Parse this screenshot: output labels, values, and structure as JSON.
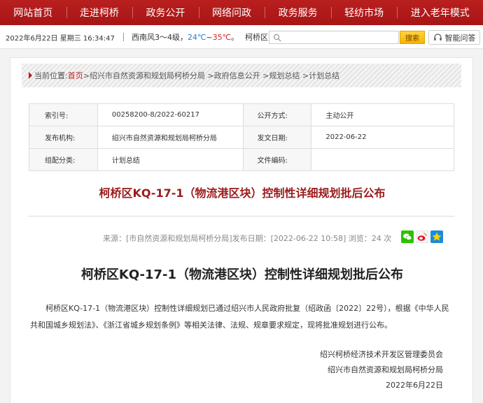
{
  "nav": {
    "items": [
      {
        "label": "网站首页"
      },
      {
        "label": "走进柯桥"
      },
      {
        "label": "政务公开"
      },
      {
        "label": "网络问政"
      },
      {
        "label": "政务服务"
      },
      {
        "label": "轻纺市场"
      },
      {
        "label": "进入老年模式"
      }
    ]
  },
  "infobar": {
    "datetime": "2022年6月22日 星期三 16:34:47",
    "weather_prefix": "西南风3～4级，",
    "temp_low": "24℃",
    "temp_sep": "~",
    "temp_high": "35℃",
    "temp_suffix": "。",
    "region": "柯桥区(",
    "search_placeholder": "",
    "search_button": "搜索",
    "qa_button": "智能问答"
  },
  "breadcrumb": {
    "prefix": "当前位置:",
    "home": "首页",
    "path": ">绍兴市自然资源和规划局柯桥分局 >政府信息公开 >规划总结 >计划总结"
  },
  "meta": {
    "rows": [
      {
        "l1": "索引号:",
        "v1": "00258200-8/2022-60217",
        "l2": "公开方式:",
        "v2": "主动公开"
      },
      {
        "l1": "发布机构:",
        "v1": "绍兴市自然资源和规划局柯桥分局",
        "l2": "发文日期:",
        "v2": "2022-06-22"
      },
      {
        "l1": "组配分类:",
        "v1": "计划总结",
        "l2": "文件编码:",
        "v2": ""
      }
    ]
  },
  "red_title": "柯桥区KQ-17-1（物流港区块）控制性详细规划批后公布",
  "source_line": "来源：[市自然资源和规划局柯桥分局]发布日期：[2022-06-22 10:58] 浏览：24 次",
  "share": {
    "wechat": "wechat-icon",
    "weibo": "weibo-icon",
    "qzone": "qzone-icon"
  },
  "article": {
    "title": "柯桥区KQ-17-1（物流港区块）控制性详细规划批后公布",
    "body": "柯桥区KQ-17-1（物流港区块）控制性详细规划已通过绍兴市人民政府批复（绍政函〔2022〕22号），根据《中华人民共和国城乡规划法》、《浙江省城乡规划条例》等相关法律、法规、规章要求规定，现将批准规划进行公布。",
    "sig1": "绍兴柯桥经济技术开发区管理委员会",
    "sig2": "绍兴市自然资源和规划局柯桥分局",
    "sig3": "2022年6月22日"
  },
  "colors": {
    "nav_red": "#b91f1f",
    "title_red": "#9c1b1b",
    "temp_low": "#1f7fd6",
    "temp_high": "#d62222",
    "search_yellow": "#f4b400"
  }
}
